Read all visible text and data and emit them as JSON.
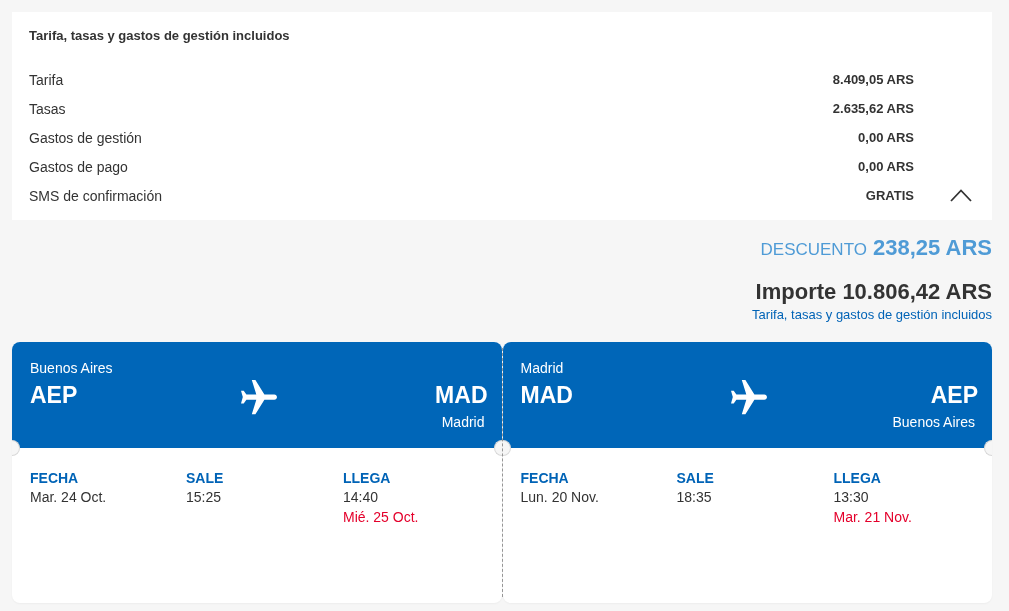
{
  "price_breakdown": {
    "title": "Tarifa, tasas y gastos de gestión incluidos",
    "expanded": true,
    "rows": [
      {
        "label": "Tarifa",
        "value": "8.409,05 ARS"
      },
      {
        "label": "Tasas",
        "value": "2.635,62 ARS"
      },
      {
        "label": "Gastos de gestión",
        "value": "0,00 ARS"
      },
      {
        "label": "Gastos de pago",
        "value": "0,00 ARS"
      },
      {
        "label": "SMS de confirmación",
        "value": "GRATIS"
      }
    ]
  },
  "discount": {
    "label": "DESCUENTO",
    "amount": "238,25 ARS"
  },
  "total": {
    "text": "Importe 10.806,42 ARS",
    "note": "Tarifa, tasas y gastos de gestión incluidos"
  },
  "flights": [
    {
      "origin": {
        "city": "Buenos Aires",
        "code": "AEP"
      },
      "destination": {
        "code": "MAD",
        "city": "Madrid"
      },
      "details": [
        {
          "label": "FECHA",
          "value": "Mar. 24 Oct."
        },
        {
          "label": "SALE",
          "value": "15:25"
        },
        {
          "label": "LLEGA",
          "value": "14:40",
          "note": "Mié. 25 Oct."
        }
      ]
    },
    {
      "origin": {
        "city": "Madrid",
        "code": "MAD"
      },
      "destination": {
        "code": "AEP",
        "city": "Buenos Aires"
      },
      "details": [
        {
          "label": "FECHA",
          "value": "Lun. 20 Nov."
        },
        {
          "label": "SALE",
          "value": "18:35"
        },
        {
          "label": "LLEGA",
          "value": "13:30",
          "note": "Mar. 21 Nov."
        }
      ]
    }
  ]
}
